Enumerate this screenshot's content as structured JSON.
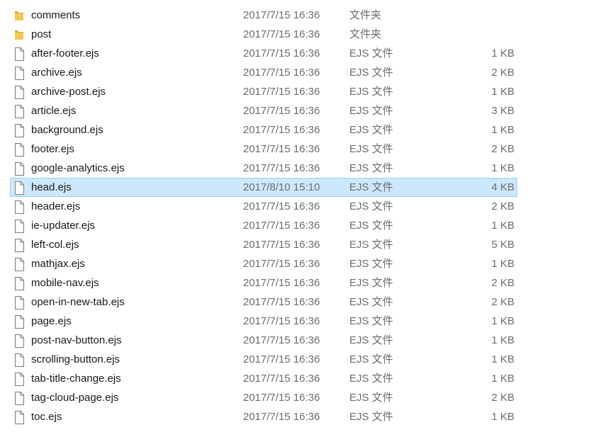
{
  "files": [
    {
      "name": "comments",
      "date": "2017/7/15 16:36",
      "type": "文件夹",
      "size": "",
      "icon": "folder-icon",
      "selected": false
    },
    {
      "name": "post",
      "date": "2017/7/15 16:36",
      "type": "文件夹",
      "size": "",
      "icon": "folder-icon",
      "selected": false
    },
    {
      "name": "after-footer.ejs",
      "date": "2017/7/15 16:36",
      "type": "EJS 文件",
      "size": "1 KB",
      "icon": "file-icon",
      "selected": false
    },
    {
      "name": "archive.ejs",
      "date": "2017/7/15 16:36",
      "type": "EJS 文件",
      "size": "2 KB",
      "icon": "file-icon",
      "selected": false
    },
    {
      "name": "archive-post.ejs",
      "date": "2017/7/15 16:36",
      "type": "EJS 文件",
      "size": "1 KB",
      "icon": "file-icon",
      "selected": false
    },
    {
      "name": "article.ejs",
      "date": "2017/7/15 16:36",
      "type": "EJS 文件",
      "size": "3 KB",
      "icon": "file-icon",
      "selected": false
    },
    {
      "name": "background.ejs",
      "date": "2017/7/15 16:36",
      "type": "EJS 文件",
      "size": "1 KB",
      "icon": "file-icon",
      "selected": false
    },
    {
      "name": "footer.ejs",
      "date": "2017/7/15 16:36",
      "type": "EJS 文件",
      "size": "2 KB",
      "icon": "file-icon",
      "selected": false
    },
    {
      "name": "google-analytics.ejs",
      "date": "2017/7/15 16:36",
      "type": "EJS 文件",
      "size": "1 KB",
      "icon": "file-icon",
      "selected": false
    },
    {
      "name": "head.ejs",
      "date": "2017/8/10 15:10",
      "type": "EJS 文件",
      "size": "4 KB",
      "icon": "file-icon",
      "selected": true
    },
    {
      "name": "header.ejs",
      "date": "2017/7/15 16:36",
      "type": "EJS 文件",
      "size": "2 KB",
      "icon": "file-icon",
      "selected": false
    },
    {
      "name": "ie-updater.ejs",
      "date": "2017/7/15 16:36",
      "type": "EJS 文件",
      "size": "1 KB",
      "icon": "file-icon",
      "selected": false
    },
    {
      "name": "left-col.ejs",
      "date": "2017/7/15 16:36",
      "type": "EJS 文件",
      "size": "5 KB",
      "icon": "file-icon",
      "selected": false
    },
    {
      "name": "mathjax.ejs",
      "date": "2017/7/15 16:36",
      "type": "EJS 文件",
      "size": "1 KB",
      "icon": "file-icon",
      "selected": false
    },
    {
      "name": "mobile-nav.ejs",
      "date": "2017/7/15 16:36",
      "type": "EJS 文件",
      "size": "2 KB",
      "icon": "file-icon",
      "selected": false
    },
    {
      "name": "open-in-new-tab.ejs",
      "date": "2017/7/15 16:36",
      "type": "EJS 文件",
      "size": "2 KB",
      "icon": "file-icon",
      "selected": false
    },
    {
      "name": "page.ejs",
      "date": "2017/7/15 16:36",
      "type": "EJS 文件",
      "size": "1 KB",
      "icon": "file-icon",
      "selected": false
    },
    {
      "name": "post-nav-button.ejs",
      "date": "2017/7/15 16:36",
      "type": "EJS 文件",
      "size": "1 KB",
      "icon": "file-icon",
      "selected": false
    },
    {
      "name": "scrolling-button.ejs",
      "date": "2017/7/15 16:36",
      "type": "EJS 文件",
      "size": "1 KB",
      "icon": "file-icon",
      "selected": false
    },
    {
      "name": "tab-title-change.ejs",
      "date": "2017/7/15 16:36",
      "type": "EJS 文件",
      "size": "1 KB",
      "icon": "file-icon",
      "selected": false
    },
    {
      "name": "tag-cloud-page.ejs",
      "date": "2017/7/15 16:36",
      "type": "EJS 文件",
      "size": "2 KB",
      "icon": "file-icon",
      "selected": false
    },
    {
      "name": "toc.ejs",
      "date": "2017/7/15 16:36",
      "type": "EJS 文件",
      "size": "1 KB",
      "icon": "file-icon",
      "selected": false
    }
  ],
  "colors": {
    "selection_fill": "#cce8ff",
    "selection_border": "#99d1ff",
    "folder": "#f2c14e",
    "secondary_text": "#6d6d6d"
  }
}
